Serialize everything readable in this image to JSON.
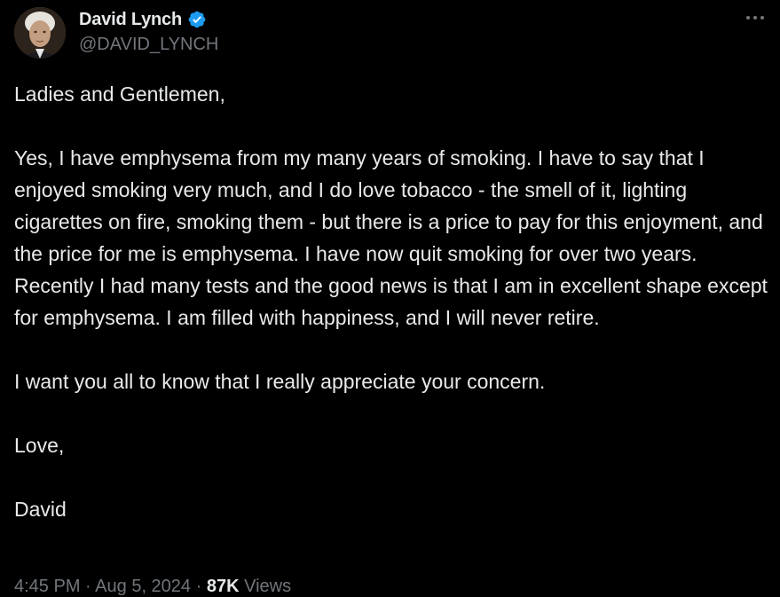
{
  "author": {
    "display_name": "David Lynch",
    "handle": "@DAVID_LYNCH",
    "verified": true
  },
  "tweet": {
    "paragraphs": [
      "Ladies and Gentlemen,",
      "Yes, I have emphysema from my many years of smoking. I have to say that I enjoyed smoking very much, and I do love tobacco - the smell of it, lighting cigarettes on fire, smoking them - but there is a price to pay for this enjoyment, and the price for me is emphysema. I have now quit smoking for over two years. Recently I had many tests and the good news is that I am in excellent shape except for emphysema. I am filled with happiness, and I will never retire.",
      "I want you all to know that I really appreciate your concern.",
      "Love,",
      "David"
    ],
    "time": "4:45 PM",
    "separator": "·",
    "date": "Aug 5, 2024",
    "views_count": "87K",
    "views_label": "Views"
  },
  "icons": {
    "verified": "verified-badge-icon",
    "more": "more-options-icon"
  },
  "colors": {
    "background": "#000000",
    "text_primary": "#e7e9ea",
    "text_secondary": "#71767b",
    "verified_blue": "#1d9bf0"
  }
}
